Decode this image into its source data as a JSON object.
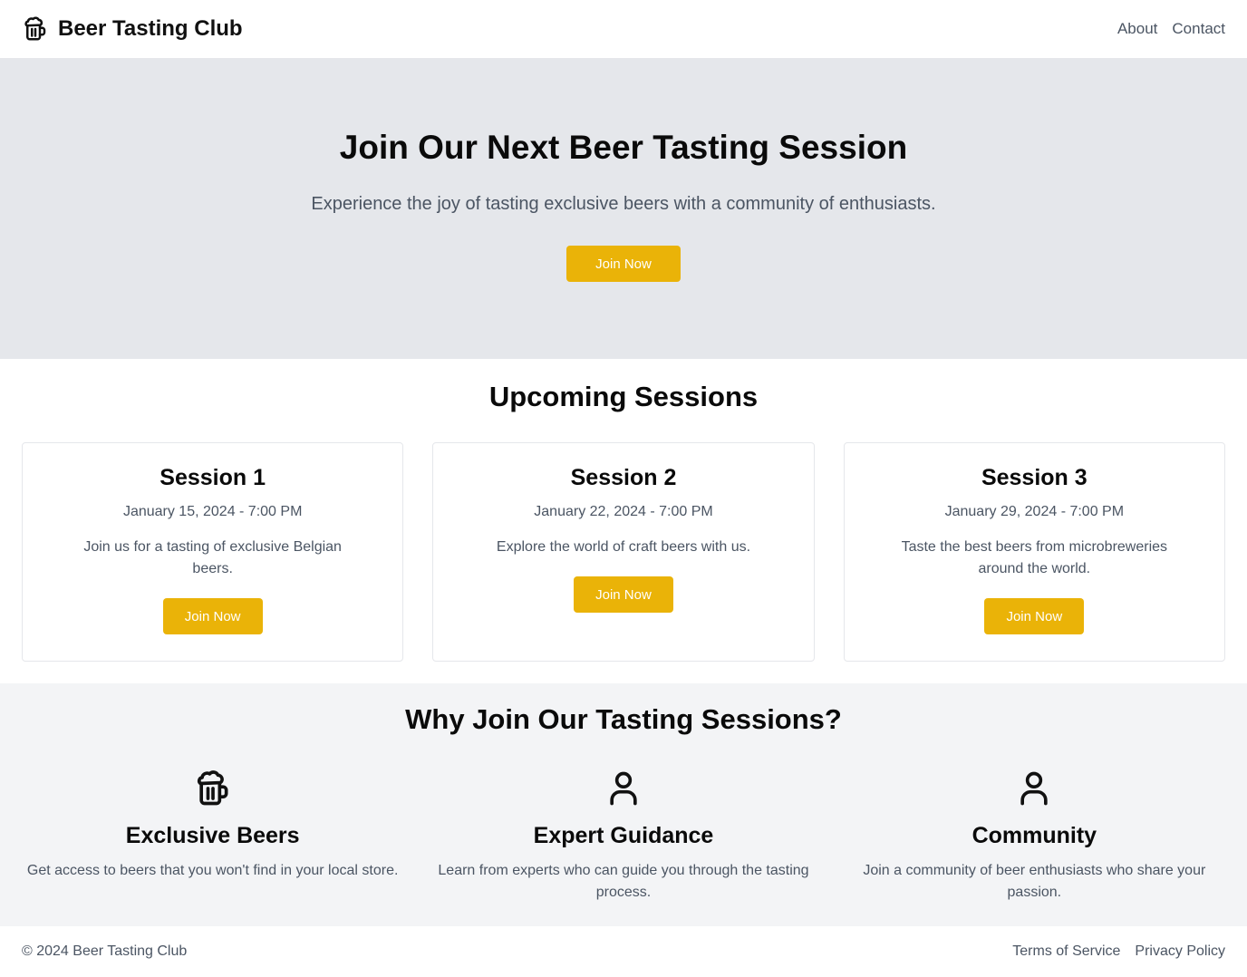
{
  "header": {
    "brand": "Beer Tasting Club",
    "brand_icon": "beer-mug-icon",
    "nav": [
      "About",
      "Contact"
    ]
  },
  "hero": {
    "title": "Join Our Next Beer Tasting Session",
    "subtitle": "Experience the joy of tasting exclusive beers with a community of enthusiasts.",
    "button": "Join Now"
  },
  "sessions": {
    "title": "Upcoming Sessions",
    "items": [
      {
        "name": "Session 1",
        "date": "January 15, 2024 - 7:00 PM",
        "description": "Join us for a tasting of exclusive Belgian beers.",
        "button": "Join Now"
      },
      {
        "name": "Session 2",
        "date": "January 22, 2024 - 7:00 PM",
        "description": "Explore the world of craft beers with us.",
        "button": "Join Now"
      },
      {
        "name": "Session 3",
        "date": "January 29, 2024 - 7:00 PM",
        "description": "Taste the best beers from microbreweries around the world.",
        "button": "Join Now"
      }
    ]
  },
  "why": {
    "title": "Why Join Our Tasting Sessions?",
    "features": [
      {
        "icon": "beer-mug-icon",
        "title": "Exclusive Beers",
        "text": "Get access to beers that you won't find in your local store."
      },
      {
        "icon": "user-icon",
        "title": "Expert Guidance",
        "text": "Learn from experts who can guide you through the tasting process."
      },
      {
        "icon": "user-icon",
        "title": "Community",
        "text": "Join a community of beer enthusiasts who share your passion."
      }
    ]
  },
  "footer": {
    "copyright": "© 2024 Beer Tasting Club",
    "links": [
      "Terms of Service",
      "Privacy Policy"
    ]
  },
  "colors": {
    "accent": "#eab308",
    "hero_bg": "#e5e7eb",
    "section_bg": "#f3f4f6",
    "muted_text": "#4b5563"
  }
}
